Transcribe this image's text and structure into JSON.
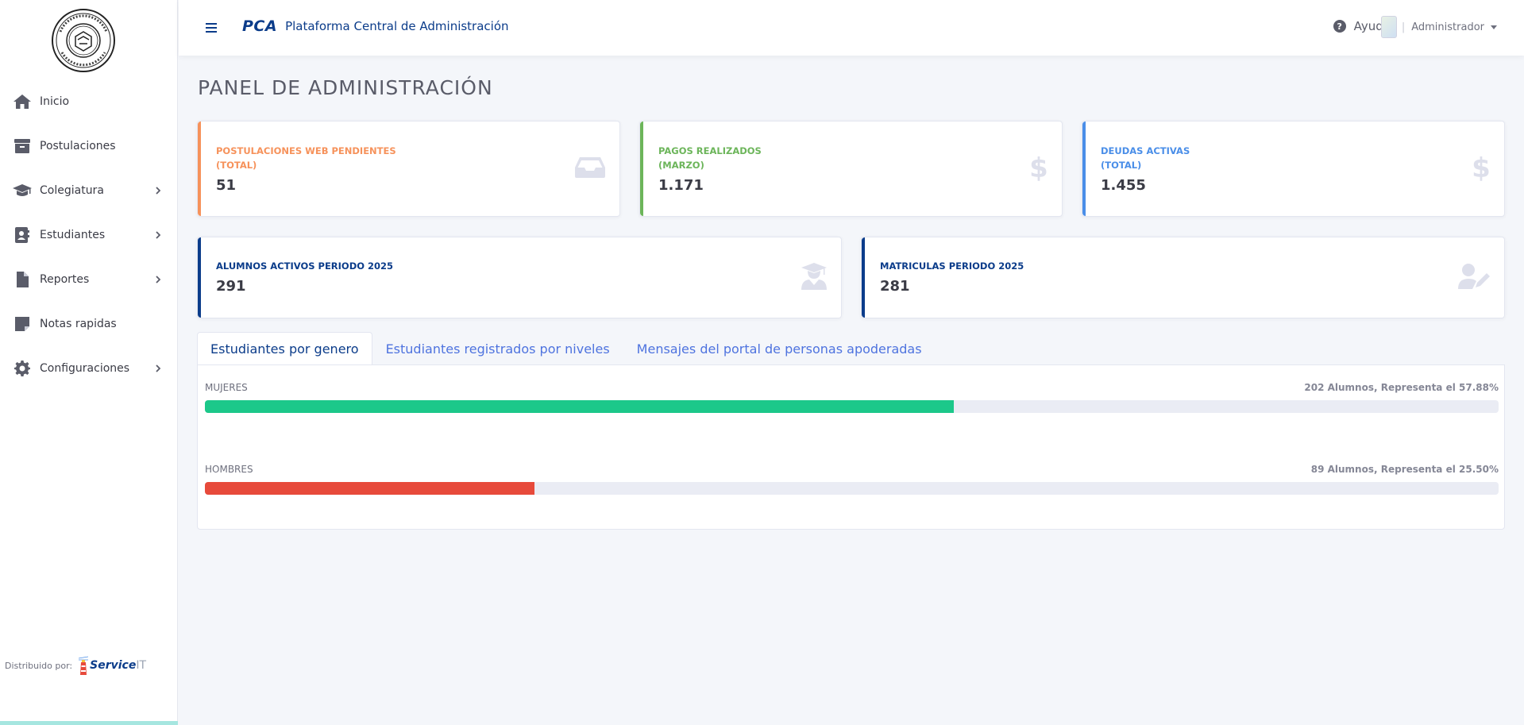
{
  "app": {
    "brand_logo": "PCA",
    "brand_title": "Plataforma Central de Administración"
  },
  "topbar": {
    "help_label": "Ayuda",
    "user_name": "Administrador",
    "separator": "|"
  },
  "sidebar": {
    "items": [
      {
        "label": "Inicio",
        "icon": "home-icon",
        "has_submenu": false
      },
      {
        "label": "Postulaciones",
        "icon": "archive-icon",
        "has_submenu": false
      },
      {
        "label": "Colegiatura",
        "icon": "graduation-cap-icon",
        "has_submenu": true
      },
      {
        "label": "Estudiantes",
        "icon": "address-book-icon",
        "has_submenu": true
      },
      {
        "label": "Reportes",
        "icon": "file-icon",
        "has_submenu": true
      },
      {
        "label": "Notas rapidas",
        "icon": "sticky-note-icon",
        "has_submenu": false
      },
      {
        "label": "Configuraciones",
        "icon": "gear-icon",
        "has_submenu": true
      }
    ],
    "distributed_label": "Distribuido por:",
    "partner_name": "Service",
    "partner_suffix": "IT"
  },
  "page": {
    "title": "PANEL DE ADMINISTRACIÓN"
  },
  "cards": [
    {
      "label_line1": "POSTULACIONES WEB PENDIENTES",
      "label_line2": "(TOTAL)",
      "value": "51",
      "color": "#f6925b",
      "icon": "inbox-icon"
    },
    {
      "label_line1": "PAGOS REALIZADOS",
      "label_line2": "(MARZO)",
      "value": "1.171",
      "color": "#6cb55a",
      "icon": "dollar-icon"
    },
    {
      "label_line1": "DEUDAS ACTIVAS",
      "label_line2": "(TOTAL)",
      "value": "1.455",
      "color": "#4a8ee8",
      "icon": "dollar-icon"
    },
    {
      "label_line1": "ALUMNOS ACTIVOS PERIODO 2025",
      "value": "291",
      "color": "#0b3c8a",
      "icon": "graduate-user-icon"
    },
    {
      "label_line1": "MATRICULAS PERIODO 2025",
      "value": "281",
      "color": "#0b3c8a",
      "icon": "user-edit-icon"
    }
  ],
  "tabs": [
    {
      "label": "Estudiantes por genero",
      "active": true
    },
    {
      "label": "Estudiantes registrados por niveles",
      "active": false
    },
    {
      "label": "Mensajes del portal de personas apoderadas",
      "active": false
    }
  ],
  "gender": [
    {
      "label": "MUJERES",
      "summary": "202 Alumnos, Representa el 57.88%",
      "percent": 57.88,
      "color": "#1cc88a"
    },
    {
      "label": "HOMBRES",
      "summary": "89 Alumnos, Representa el 25.50%",
      "percent": 25.5,
      "color": "#e74a3b"
    }
  ]
}
